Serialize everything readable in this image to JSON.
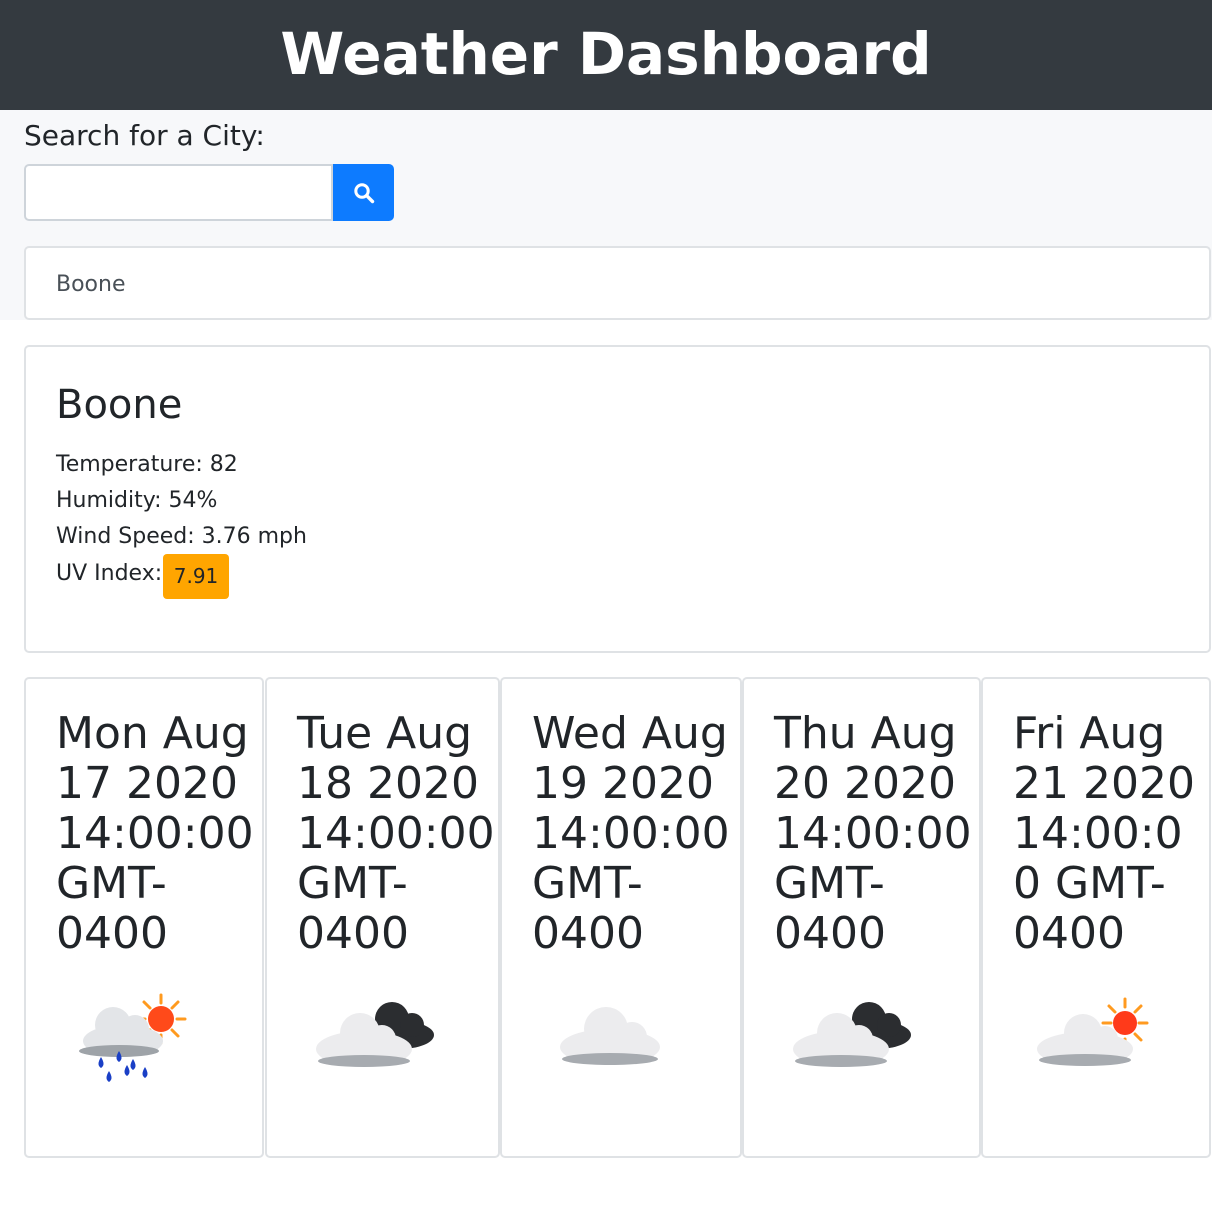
{
  "header": {
    "title": "Weather Dashboard"
  },
  "search": {
    "label": "Search for a City:",
    "input_value": "",
    "placeholder": "",
    "button_icon": "search-icon",
    "accent_color": "#0d7bff"
  },
  "history": [
    "Boone"
  ],
  "current": {
    "city": "Boone",
    "temperature": "Temperature: 82",
    "humidity": "Humidity: 54%",
    "wind": "Wind Speed: 3.76 mph",
    "uv_label": "UV Index:",
    "uv_value": "7.91",
    "uv_color": "#ffa500"
  },
  "forecast": [
    {
      "date": "Mon Aug 17 2020 14:00:00 GMT-0400",
      "icon": "rain-sun-icon"
    },
    {
      "date": "Tue Aug 18 2020 14:00:00 GMT-0400",
      "icon": "broken-clouds-icon"
    },
    {
      "date": "Wed Aug 19 2020 14:00:00 GMT-0400",
      "icon": "cloud-icon"
    },
    {
      "date": "Thu Aug 20 2020 14:00:00 GMT-0400",
      "icon": "broken-clouds-icon"
    },
    {
      "date": "Fri Aug 21 2020 14:00:00 GMT-0400",
      "icon": "partly-cloudy-icon"
    }
  ]
}
